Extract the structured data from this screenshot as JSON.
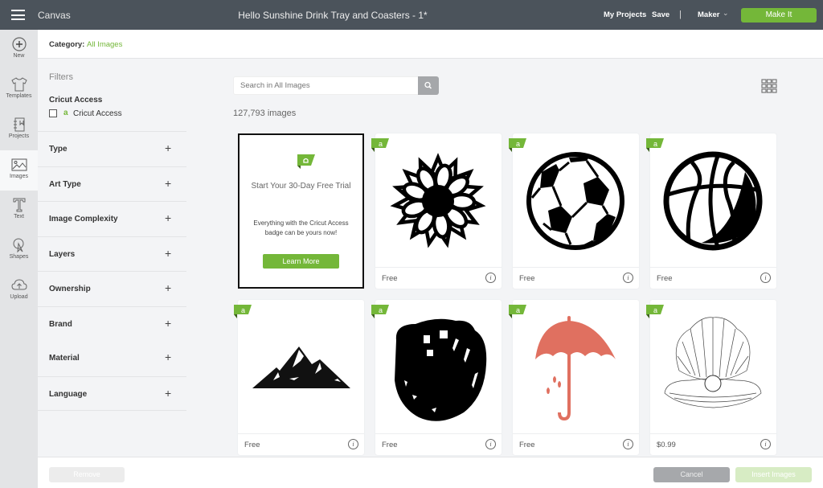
{
  "topbar": {
    "app_name": "Canvas",
    "doc_title": "Hello Sunshine Drink Tray and Coasters - 1*",
    "my_projects": "My Projects",
    "save": "Save",
    "separator": "|",
    "machine": "Maker",
    "make_it": "Make It"
  },
  "leftnav": {
    "items": [
      {
        "label": "New",
        "icon": "plus-circle-icon"
      },
      {
        "label": "Templates",
        "icon": "tshirt-icon"
      },
      {
        "label": "Projects",
        "icon": "notebook-icon"
      },
      {
        "label": "Images",
        "icon": "image-icon",
        "active": true
      },
      {
        "label": "Text",
        "icon": "text-t-icon"
      },
      {
        "label": "Shapes",
        "icon": "shapes-icon"
      },
      {
        "label": "Upload",
        "icon": "cloud-upload-icon"
      }
    ]
  },
  "category": {
    "label": "Category:",
    "value": "All Images"
  },
  "filters": {
    "title": "Filters",
    "access_heading": "Cricut Access",
    "access_badge": "a",
    "access_option": "Cricut Access",
    "access_checked": false,
    "groups": [
      "Type",
      "Art Type",
      "Image Complexity",
      "Layers",
      "Ownership",
      "Brand",
      "Material",
      "Language"
    ],
    "expand_symbol": "+"
  },
  "search": {
    "placeholder": "Search in All Images",
    "value": ""
  },
  "results": {
    "count": "127,793 images"
  },
  "promo": {
    "title": "Start Your 30-Day Free Trial",
    "description": "Everything with the Cricut Access badge can be yours now!",
    "button": "Learn More"
  },
  "images": [
    {
      "name": "sunflower",
      "price": "Free",
      "badge": "a"
    },
    {
      "name": "soccer-ball",
      "price": "Free",
      "badge": "a"
    },
    {
      "name": "basketball",
      "price": "Free",
      "badge": "a"
    },
    {
      "name": "mountains",
      "price": "Free",
      "badge": "a"
    },
    {
      "name": "baseball-glove",
      "price": "Free",
      "badge": "a"
    },
    {
      "name": "umbrella",
      "price": "Free",
      "badge": "a"
    },
    {
      "name": "seashell-pearl",
      "price": "$0.99",
      "badge": "a"
    }
  ],
  "info_symbol": "i",
  "colors": {
    "accent": "#74b739",
    "topbar": "#4b535b",
    "umbrella": "#e07060"
  },
  "footer": {
    "remove": "Remove",
    "cancel": "Cancel",
    "insert": "Insert Images"
  }
}
